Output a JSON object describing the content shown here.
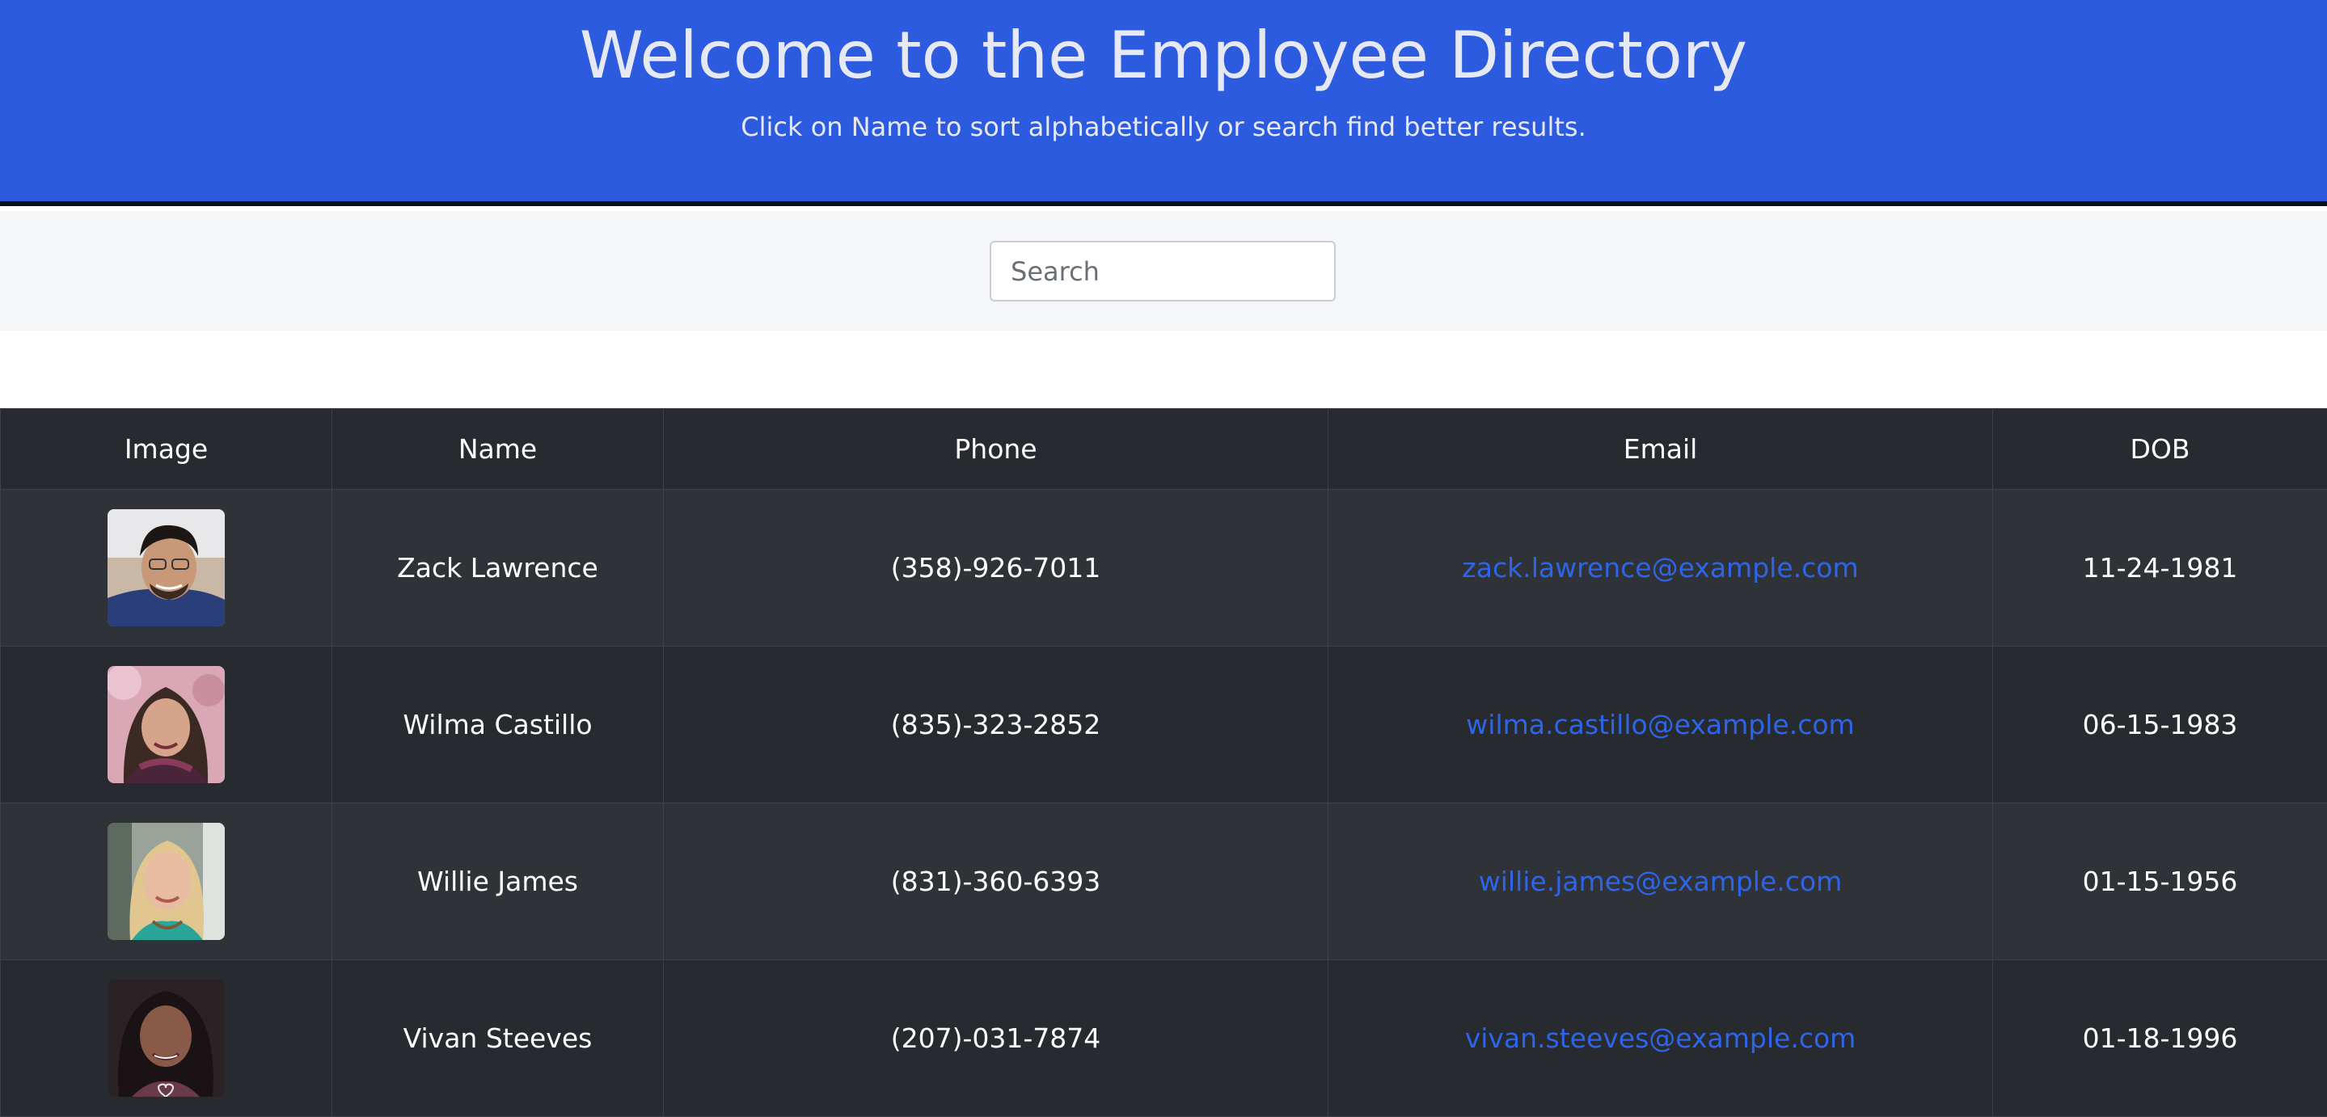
{
  "header": {
    "title": "Welcome to the Employee Directory",
    "subtitle": "Click on Name to sort alphabetically or search find better results."
  },
  "search": {
    "placeholder": "Search",
    "value": ""
  },
  "table": {
    "columns": [
      "Image",
      "Name",
      "Phone",
      "Email",
      "DOB"
    ],
    "rows": [
      {
        "name": "Zack Lawrence",
        "phone": "(358)-926-7011",
        "email": "zack.lawrence@example.com",
        "dob": "11-24-1981"
      },
      {
        "name": "Wilma Castillo",
        "phone": "(835)-323-2852",
        "email": "wilma.castillo@example.com",
        "dob": "06-15-1983"
      },
      {
        "name": "Willie James",
        "phone": "(831)-360-6393",
        "email": "willie.james@example.com",
        "dob": "01-15-1956"
      },
      {
        "name": "Vivan Steeves",
        "phone": "(207)-031-7874",
        "email": "vivan.steeves@example.com",
        "dob": "01-18-1996"
      }
    ]
  },
  "colors": {
    "header_bg": "#2d5be0",
    "table_bg": "#272b2f",
    "link": "#2e65e8"
  }
}
